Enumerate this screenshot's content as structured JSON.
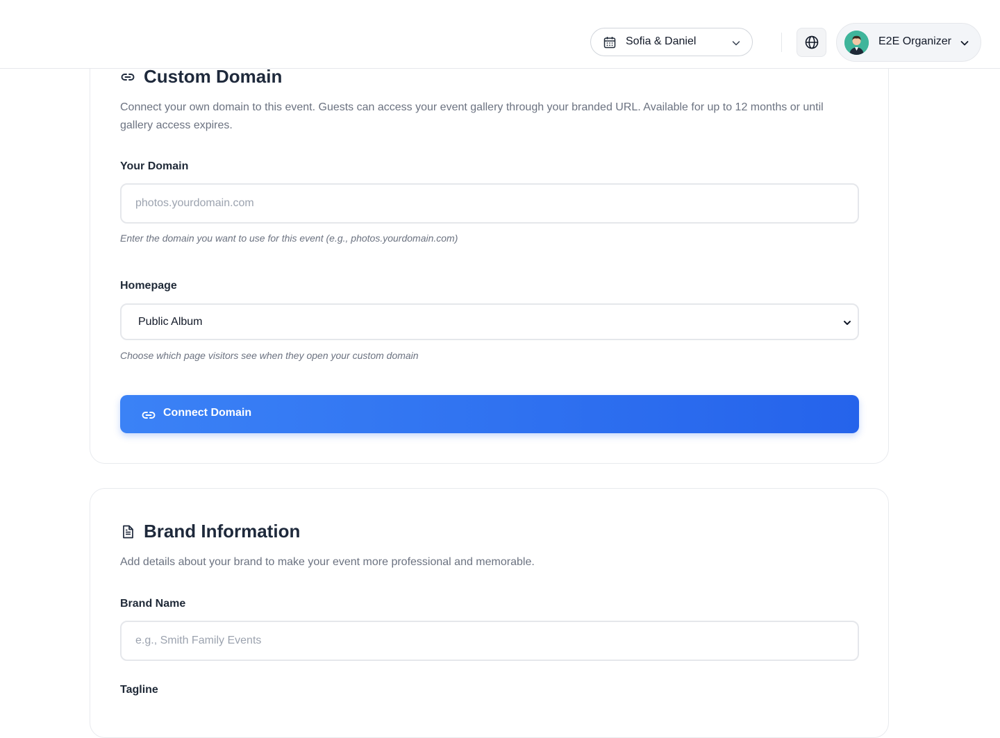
{
  "header": {
    "event_selector": {
      "label": "Sofia & Daniel",
      "icon": "calendar-icon"
    },
    "language_icon": "globe-icon",
    "user": {
      "name": "E2E Organizer",
      "avatar_bg": "#3fb59b"
    }
  },
  "custom_domain": {
    "title": "Custom Domain",
    "icon": "link-icon",
    "description": "Connect your own domain to this event. Guests can access your event gallery through your branded URL. Available for up to 12 months or until gallery access expires.",
    "domain_label": "Your Domain",
    "domain_placeholder": "photos.yourdomain.com",
    "domain_value": "",
    "domain_hint": "Enter the domain you want to use for this event (e.g., photos.yourdomain.com)",
    "homepage_label": "Homepage",
    "homepage_selected": "Public Album",
    "homepage_hint": "Choose which page visitors see when they open your custom domain",
    "connect_button": "Connect Domain"
  },
  "brand_information": {
    "title": "Brand Information",
    "icon": "document-icon",
    "description": "Add details about your brand to make your event more professional and memorable.",
    "brand_name_label": "Brand Name",
    "brand_name_placeholder": "e.g., Smith Family Events",
    "brand_name_value": "",
    "tagline_label": "Tagline"
  },
  "colors": {
    "primary": "#2563eb",
    "primary_light": "#3b82f6",
    "text": "#1e293b",
    "muted": "#6b7280",
    "border": "#e5e7eb"
  }
}
